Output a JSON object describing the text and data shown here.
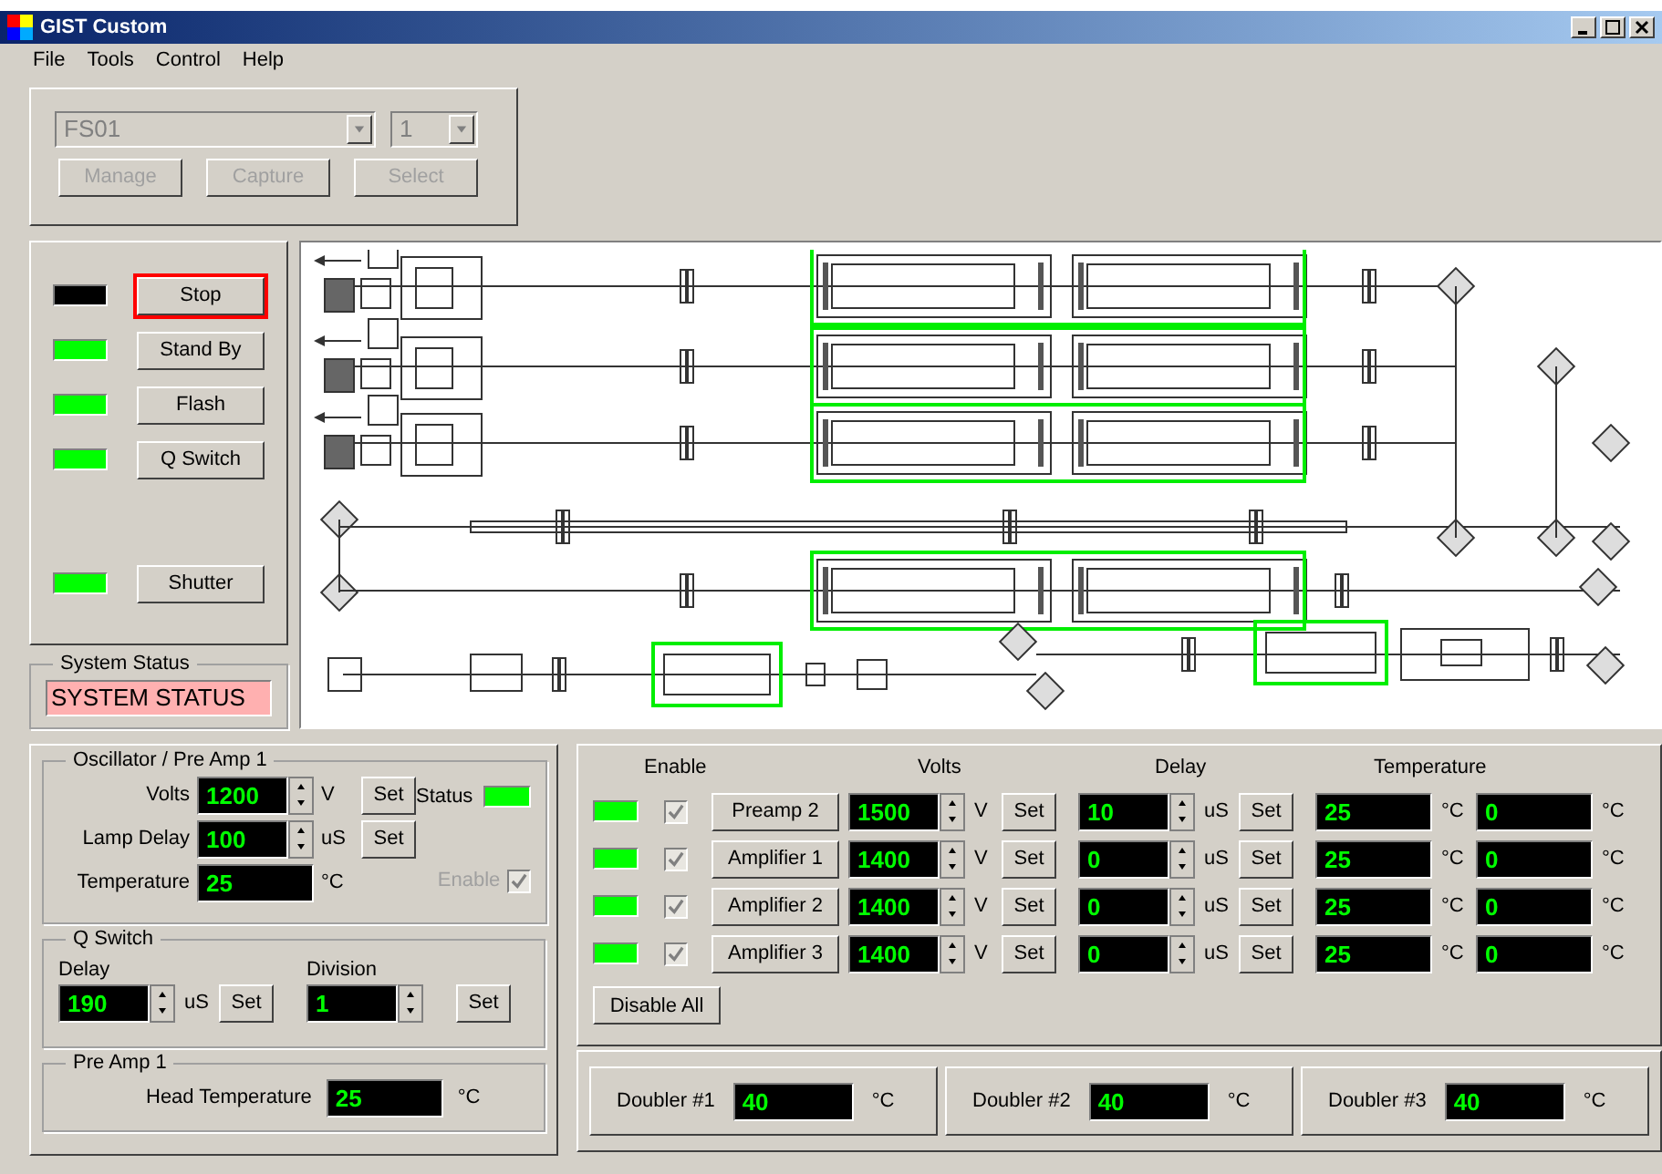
{
  "window": {
    "title": "GIST Custom"
  },
  "menu": [
    "File",
    "Tools",
    "Control",
    "Help"
  ],
  "system_select": {
    "system": "FS01",
    "unit": "1",
    "disabled": true,
    "buttons": [
      "Manage",
      "Capture",
      "Select"
    ]
  },
  "controls": [
    {
      "label": "Stop",
      "on": false,
      "focused": true
    },
    {
      "label": "Stand By",
      "on": true,
      "focused": false
    },
    {
      "label": "Flash",
      "on": true,
      "focused": false
    },
    {
      "label": "Q Switch",
      "on": true,
      "focused": false
    },
    {
      "label": "Shutter",
      "on": true,
      "focused": false
    }
  ],
  "system_status": {
    "title": "System Status",
    "text": "SYSTEM STATUS"
  },
  "oscillator": {
    "title": "Oscillator / Pre Amp 1",
    "fields": [
      {
        "label": "Volts",
        "value": "1200",
        "unit": "V",
        "kind": "spin",
        "button": "Set"
      },
      {
        "label": "Lamp Delay",
        "value": "100",
        "unit": "uS",
        "kind": "spin",
        "button": "Set"
      },
      {
        "label": "Temperature",
        "value": "25",
        "unit": "°C",
        "kind": "readout"
      }
    ],
    "status_label": "Status",
    "status_on": true,
    "enable_label": "Enable",
    "enable_checked": true
  },
  "q_switch": {
    "title": "Q Switch",
    "delay": {
      "label": "Delay",
      "value": "190",
      "unit": "uS",
      "button": "Set"
    },
    "division": {
      "label": "Division",
      "value": "1",
      "button": "Set"
    }
  },
  "pre_amp": {
    "title": "Pre Amp 1",
    "label": "Head Temperature",
    "value": "25",
    "unit": "°C"
  },
  "amplifiers": {
    "columns": [
      "Enable",
      "Volts",
      "Delay",
      "Temperature"
    ],
    "rows": [
      {
        "on": true,
        "checked": true,
        "name": "Preamp 2",
        "volts": "1500",
        "volts_unit": "V",
        "volts_button": "Set",
        "delay": "10",
        "delay_unit": "uS",
        "delay_button": "Set",
        "temperature": "25",
        "temperature_unit": "°C",
        "column_5": "0",
        "column_5_unit": "°C"
      },
      {
        "on": true,
        "checked": true,
        "name": "Amplifier 1",
        "volts": "1400",
        "volts_unit": "V",
        "volts_button": "Set",
        "delay": "0",
        "delay_unit": "uS",
        "delay_button": "Set",
        "temperature": "25",
        "temperature_unit": "°C",
        "column_5": "0",
        "column_5_unit": "°C"
      },
      {
        "on": true,
        "checked": true,
        "name": "Amplifier 2",
        "volts": "1400",
        "volts_unit": "V",
        "volts_button": "Set",
        "delay": "0",
        "delay_unit": "uS",
        "delay_button": "Set",
        "temperature": "25",
        "temperature_unit": "°C",
        "column_5": "0",
        "column_5_unit": "°C"
      },
      {
        "on": true,
        "checked": true,
        "name": "Amplifier 3",
        "volts": "1400",
        "volts_unit": "V",
        "volts_button": "Set",
        "delay": "0",
        "delay_unit": "uS",
        "delay_button": "Set",
        "temperature": "25",
        "temperature_unit": "°C",
        "column_5": "0",
        "column_5_unit": "°C"
      }
    ],
    "disable_all": "Disable All"
  },
  "doublers": [
    {
      "label": "Doubler #1",
      "value": "40",
      "unit": "°C"
    },
    {
      "label": "Doubler #2",
      "value": "40",
      "unit": "°C"
    },
    {
      "label": "Doubler #3",
      "value": "40",
      "unit": "°C"
    }
  ]
}
